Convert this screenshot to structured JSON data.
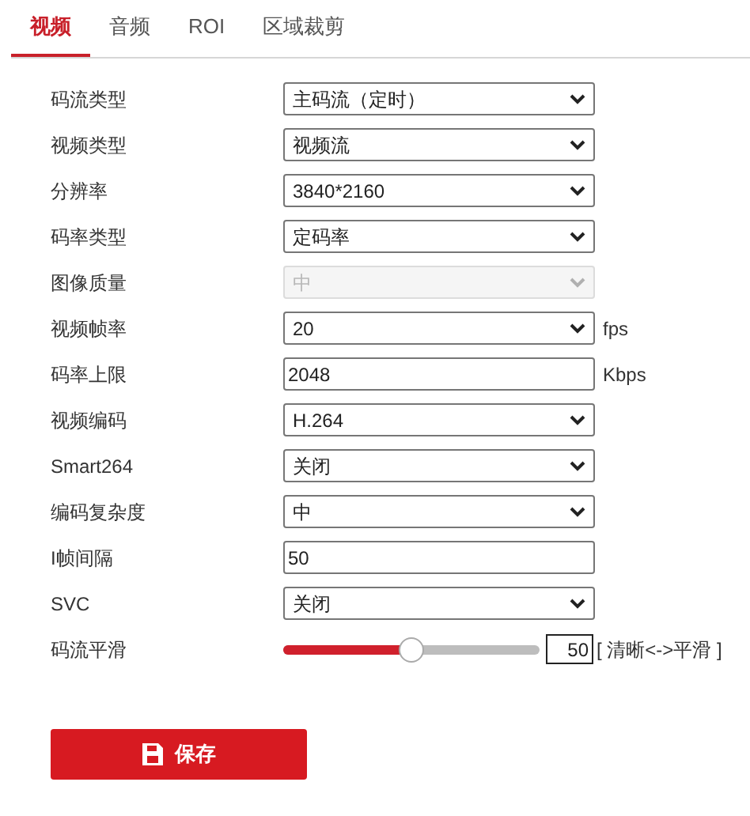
{
  "tabs": [
    {
      "label": "视频",
      "selected": true
    },
    {
      "label": "音频",
      "selected": false
    },
    {
      "label": "ROI",
      "selected": false
    },
    {
      "label": "区域裁剪",
      "selected": false
    }
  ],
  "fields": [
    {
      "kind": "select",
      "label": "码流类型",
      "value": "主码流（定时）",
      "disabled": false
    },
    {
      "kind": "select",
      "label": "视频类型",
      "value": "视频流",
      "disabled": false
    },
    {
      "kind": "select",
      "label": "分辨率",
      "value": "3840*2160",
      "disabled": false
    },
    {
      "kind": "select",
      "label": "码率类型",
      "value": "定码率",
      "disabled": false
    },
    {
      "kind": "select",
      "label": "图像质量",
      "value": "中",
      "disabled": true
    },
    {
      "kind": "select",
      "label": "视频帧率",
      "value": "20",
      "disabled": false,
      "unit": "fps"
    },
    {
      "kind": "input",
      "label": "码率上限",
      "value": "2048",
      "unit": "Kbps"
    },
    {
      "kind": "select",
      "label": "视频编码",
      "value": "H.264",
      "disabled": false
    },
    {
      "kind": "select",
      "label": "Smart264",
      "value": "关闭",
      "disabled": false
    },
    {
      "kind": "select",
      "label": "编码复杂度",
      "value": "中",
      "disabled": false
    },
    {
      "kind": "input",
      "label": "I帧间隔",
      "value": "50"
    },
    {
      "kind": "select",
      "label": "SVC",
      "value": "关闭",
      "disabled": false
    },
    {
      "kind": "slider",
      "label": "码流平滑",
      "level": 0.5,
      "value": "50",
      "hint": "[ 清晰<->平滑 ]"
    }
  ],
  "save_button": {
    "label": "保存"
  }
}
